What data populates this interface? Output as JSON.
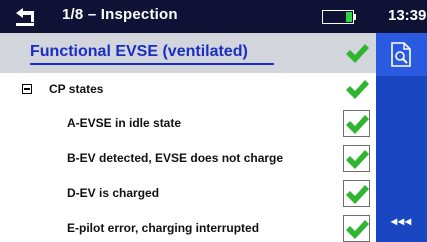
{
  "header": {
    "title": "1/8 – Inspection",
    "time": "13:39",
    "back_icon": "return-arrow-icon",
    "battery_icon": "battery-icon"
  },
  "inspection": {
    "title": "Functional EVSE (ventilated)",
    "status": "pass"
  },
  "group": {
    "label": "CP states",
    "status": "pass",
    "expander": "collapse"
  },
  "items": [
    {
      "label": "A-EVSE in idle state",
      "checked": true
    },
    {
      "label": "B-EV detected, EVSE does not charge",
      "checked": true
    },
    {
      "label": "D-EV is charged",
      "checked": true
    },
    {
      "label": "E-pilot error, charging interrupted",
      "checked": true
    }
  ],
  "sidebar": {
    "report_icon": "document-search-icon",
    "more_label": "◂◂◂"
  },
  "colors": {
    "topbar": "#0f1235",
    "sidebar": "#1a46c2",
    "accent_text": "#1a2ec4",
    "check": "#2fb52f",
    "header_row": "#d3d5dc"
  }
}
